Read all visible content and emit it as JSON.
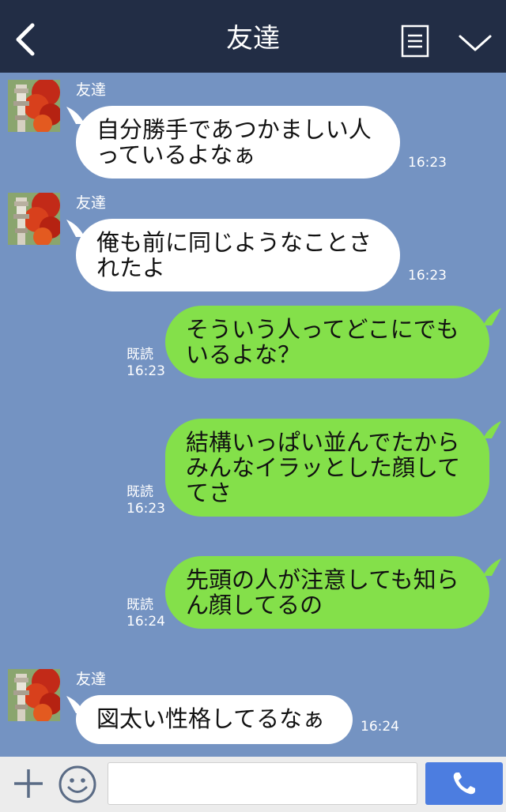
{
  "header": {
    "title": "友達",
    "back_icon": "chevron-left-icon",
    "menu_icon": "document-list-icon",
    "dropdown_icon": "chevron-down-icon"
  },
  "messages": [
    {
      "side": "in",
      "sender": "友達",
      "lines": [
        "自分勝手であつかましい人",
        "っているよなぁ"
      ],
      "time": "16:23"
    },
    {
      "side": "in",
      "sender": "友達",
      "lines": [
        "俺も前に同じようなことさ",
        "れたよ"
      ],
      "time": "16:23"
    },
    {
      "side": "out",
      "read": "既読",
      "lines": [
        "そういう人ってどこにでも",
        "いるよな？"
      ],
      "time": "16:23"
    },
    {
      "side": "out",
      "read": "既読",
      "lines": [
        "結構いっぱい並んでたから",
        "みんなイラッとした顔して",
        "てさ"
      ],
      "time": "16:23"
    },
    {
      "side": "out",
      "read": "既読",
      "lines": [
        "先頭の人が注意しても知ら",
        "ん顔してるの"
      ],
      "time": "16:24"
    },
    {
      "side": "in",
      "sender": "友達",
      "lines": [
        "図太い性格してるなぁ"
      ],
      "time": "16:24"
    }
  ],
  "input": {
    "value": ""
  },
  "colors": {
    "header_bg": "#222d45",
    "chat_bg": "#7493c2",
    "bubble_in": "#ffffff",
    "bubble_out": "#84e04a",
    "call_button": "#4c7de0"
  }
}
